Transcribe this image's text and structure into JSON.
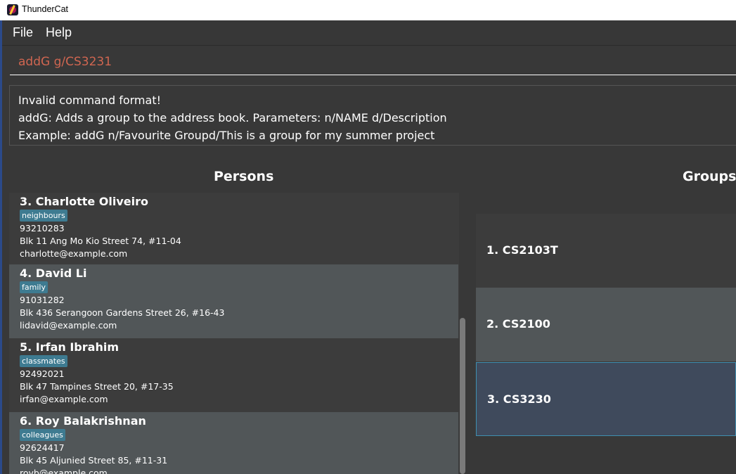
{
  "window": {
    "title": "ThunderCat"
  },
  "menu": {
    "file": "File",
    "help": "Help"
  },
  "command": {
    "value": "addG g/CS3231"
  },
  "result": {
    "lines": [
      "Invalid command format!",
      "addG: Adds a group to the address book. Parameters: n/NAME d/Description",
      "Example: addG n/Favourite Groupd/This is a group for my summer project"
    ]
  },
  "persons": {
    "title": "Persons",
    "items": [
      {
        "name": "3.  Charlotte Oliveiro",
        "tag": "neighbours",
        "phone": "93210283",
        "address": "Blk 11 Ang Mo Kio Street 74, #11-04",
        "email": "charlotte@example.com"
      },
      {
        "name": "4.  David Li",
        "tag": "family",
        "phone": "91031282",
        "address": "Blk 436 Serangoon Gardens Street 26, #16-43",
        "email": "lidavid@example.com"
      },
      {
        "name": "5.  Irfan Ibrahim",
        "tag": "classmates",
        "phone": "92492021",
        "address": "Blk 47 Tampines Street 20, #17-35",
        "email": "irfan@example.com"
      },
      {
        "name": "6.  Roy Balakrishnan",
        "tag": "colleagues",
        "phone": "92624417",
        "address": "Blk 45 Aljunied Street 85, #11-31",
        "email": "royb@example.com"
      }
    ]
  },
  "groups": {
    "title": "Groups",
    "items": [
      {
        "name": "1.  CS2103T"
      },
      {
        "name": "2.  CS2100"
      },
      {
        "name": "3.  CS3230"
      }
    ]
  },
  "colors": {
    "background": "#383838",
    "command_text": "#d06651",
    "tag": "#3e7b91",
    "selected_group": "#3f4a5c"
  }
}
